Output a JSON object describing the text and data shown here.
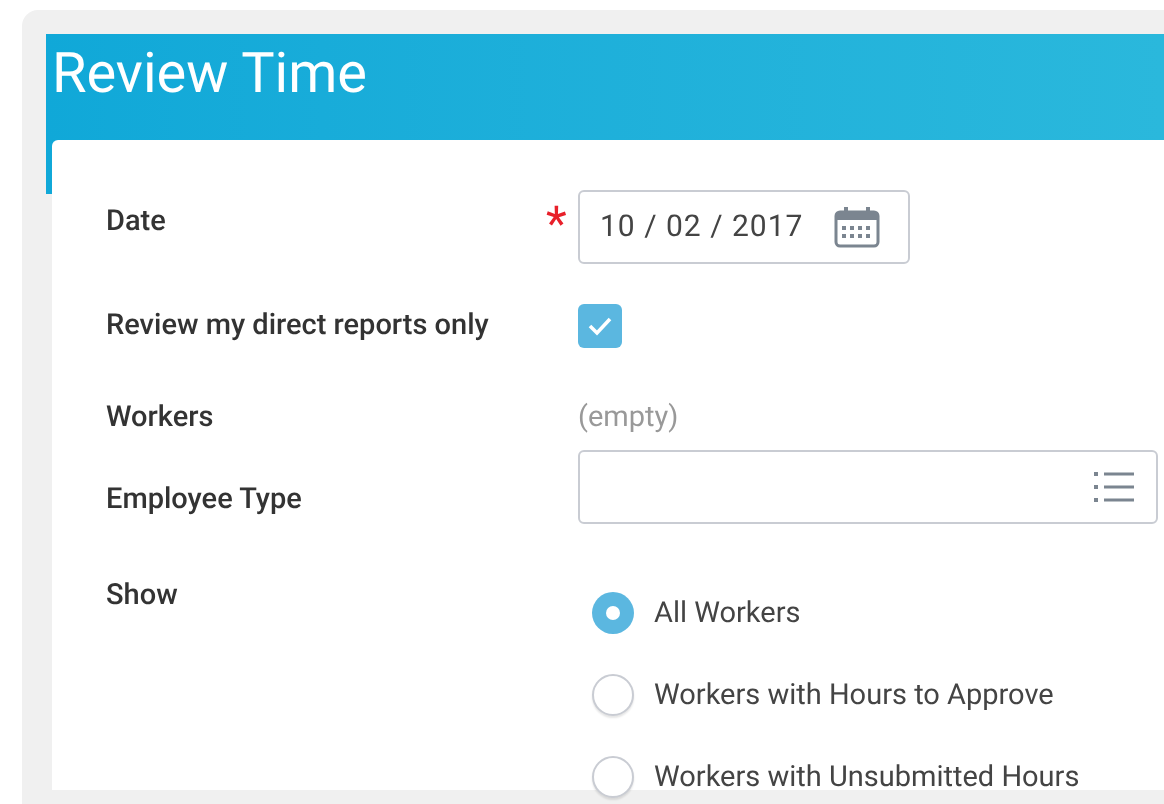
{
  "header": {
    "title": "Review Time"
  },
  "fields": [
    {
      "kind": "date",
      "label": "Date",
      "required_mark": "*",
      "value": "10 / 02 / 2017"
    },
    {
      "kind": "checkbox",
      "label": "Review my direct reports only",
      "checked": true
    },
    {
      "kind": "text",
      "label": "Workers",
      "value": "(empty)"
    },
    {
      "kind": "select",
      "label": "Employee Type"
    },
    {
      "kind": "radio",
      "label": "Show",
      "options": [
        {
          "label": "All Workers",
          "selected": true
        },
        {
          "label": "Workers with Hours to Approve",
          "selected": false
        },
        {
          "label": "Workers with Unsubmitted Hours",
          "selected": false
        }
      ]
    }
  ]
}
